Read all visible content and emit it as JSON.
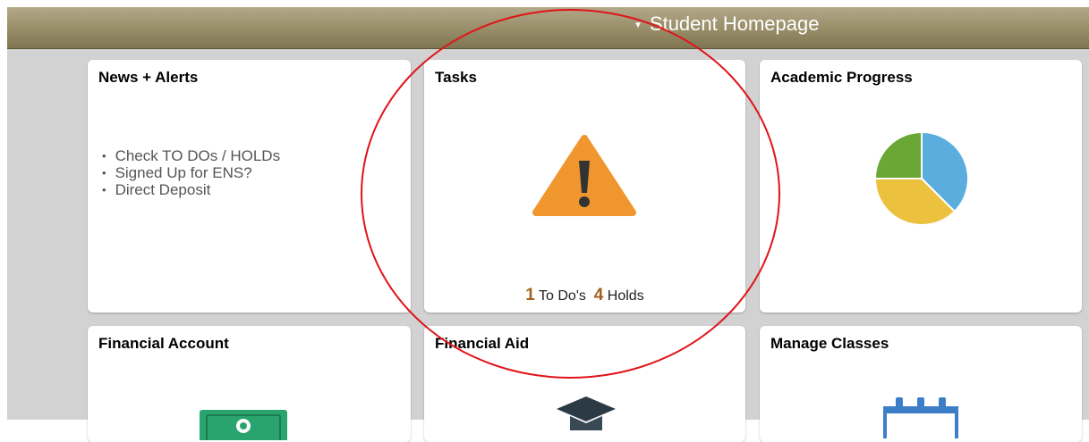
{
  "header": {
    "title": "Student Homepage"
  },
  "tiles": {
    "news": {
      "title": "News + Alerts",
      "items": [
        "Check TO DOs / HOLDs",
        "Signed Up for ENS?",
        "Direct Deposit"
      ]
    },
    "tasks": {
      "title": "Tasks",
      "todo_count": "1",
      "todo_label": "To Do's",
      "holds_count": "4",
      "holds_label": "Holds",
      "icon": "warning-icon"
    },
    "academic_progress": {
      "title": "Academic Progress",
      "icon": "pie-chart-icon"
    },
    "financial_account": {
      "title": "Financial Account",
      "icon": "money-icon"
    },
    "financial_aid": {
      "title": "Financial Aid",
      "icon": "graduation-cap-icon"
    },
    "manage_classes": {
      "title": "Manage Classes",
      "icon": "calendar-icon"
    }
  },
  "colors": {
    "header": "#978d67",
    "warning": "#f0962e",
    "count_accent": "#a0611c",
    "annotation": "#e0141a",
    "pie_blue": "#5badde",
    "pie_yellow": "#ecc13e",
    "pie_green": "#6aa735"
  }
}
